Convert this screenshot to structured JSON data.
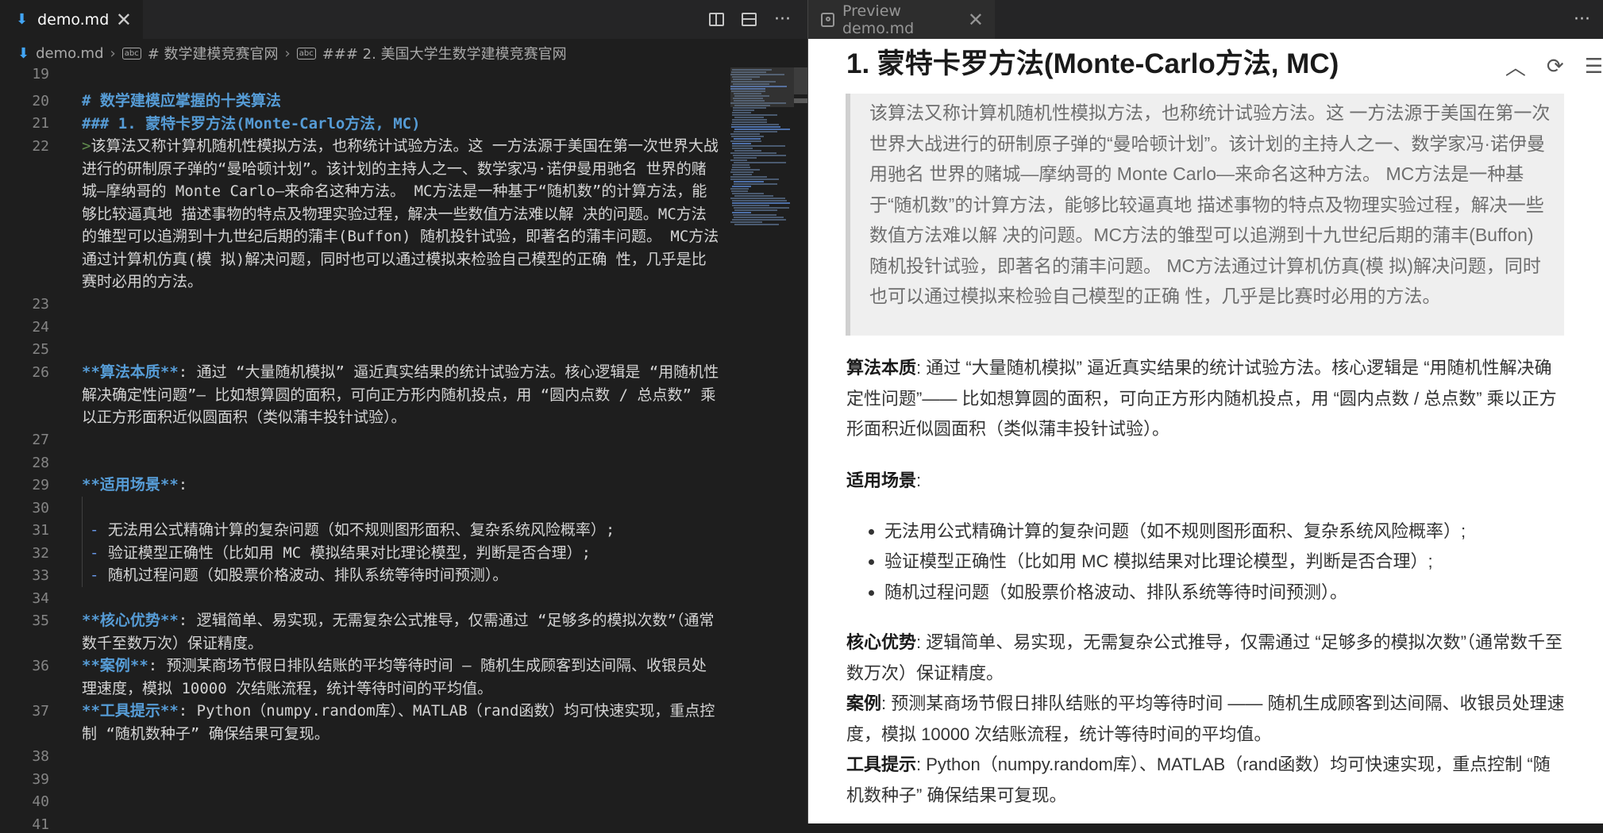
{
  "editor": {
    "tab": {
      "filename": "demo.md",
      "close": "✕"
    },
    "actions": {
      "more": "···"
    },
    "breadcrumb": {
      "file": "demo.md",
      "h1": "# 数学建模竞赛官网",
      "h2": "### 2. 美国大学生数学建模竞赛官网"
    },
    "lines": {
      "n19": "19",
      "n20": "20",
      "n21": "21",
      "n22": "22",
      "n23": "23",
      "n24": "24",
      "n25": "25",
      "n26": "26",
      "n27": "27",
      "n28": "28",
      "n29": "29",
      "n30": "30",
      "n31": "31",
      "n32": "32",
      "n33": "33",
      "n34": "34",
      "n35": "35",
      "n36": "36",
      "n37": "37",
      "n38": "38",
      "n39": "39",
      "n40": "40",
      "n41": "41"
    },
    "code": {
      "l20": "# 数学建模应掌握的十类算法",
      "l21": "### 1. 蒙特卡罗方法(Monte-Carlo方法, MC)",
      "l22_marker": ">",
      "l22": "该算法又称计算机随机性模拟方法，也称统计试验方法。这 一方法源于美国在第一次世界大战进行的研制原子弹的“曼哈顿计划”。该计划的主持人之一、数学家冯·诺伊曼用驰名 世界的赌城—摩纳哥的 Monte Carlo—来命名这种方法。 MC方法是一种基于“随机数”的计算方法，能够比较逼真地 描述事物的特点及物理实验过程，解决一些数值方法难以解 决的问题。MC方法的雏型可以追溯到十九世纪后期的蒲丰(Buffon) 随机投针试验，即著名的蒲丰问题。 MC方法通过计算机仿真(模 拟)解决问题，同时也可以通过模拟来检验自己模型的正确 性，几乎是比赛时必用的方法。",
      "l26_bold": "**算法本质**",
      "l26": ": 通过 “大量随机模拟” 逼近真实结果的统计试验方法。核心逻辑是 “用随机性解决确定性问题”— 比如想算圆的面积，可向正方形内随机投点，用 “圆内点数 / 总点数” 乘以正方形面积近似圆面积（类似蒲丰投针试验）。",
      "l29_bold": "**适用场景**",
      "l29": ":",
      "dash": "-",
      "l31": "无法用公式精确计算的复杂问题（如不规则图形面积、复杂系统风险概率）;",
      "l32": "验证模型正确性（比如用 MC 模拟结果对比理论模型，判断是否合理）;",
      "l33": "随机过程问题（如股票价格波动、排队系统等待时间预测）。",
      "l35_bold": "**核心优势**",
      "l35": ": 逻辑简单、易实现，无需复杂公式推导，仅需通过 “足够多的模拟次数”（通常数千至数万次）保证精度。",
      "l36_bold": "**案例**",
      "l36": ": 预测某商场节假日排队结账的平均等待时间 — 随机生成顾客到达间隔、收银员处理速度，模拟 10000 次结账流程，统计等待时间的平均值。",
      "l37_bold": "**工具提示**",
      "l37": ": Python（numpy.random库）、MATLAB（rand函数）均可快速实现，重点控制 “随机数种子” 确保结果可复现。"
    }
  },
  "preview": {
    "tab": {
      "title": "Preview demo.md",
      "close": "✕"
    },
    "actions": {
      "more": "···"
    },
    "heading": "1. 蒙特卡罗方法(Monte-Carlo方法, MC)",
    "tools": {
      "up": "︿",
      "refresh": "⟳",
      "toc": "☰"
    },
    "quote": "该算法又称计算机随机性模拟方法，也称统计试验方法。这 一方法源于美国在第一次世界大战进行的研制原子弹的“曼哈顿计划”。该计划的主持人之一、数学家冯·诺伊曼用驰名 世界的赌城—摩纳哥的 Monte Carlo—来命名这种方法。 MC方法是一种基于“随机数”的计算方法，能够比较逼真地 描述事物的特点及物理实验过程，解决一些数值方法难以解 决的问题。MC方法的雏型可以追溯到十九世纪后期的蒲丰(Buffon) 随机投针试验，即著名的蒲丰问题。 MC方法通过计算机仿真(模 拟)解决问题，同时也可以通过模拟来检验自己模型的正确 性，几乎是比赛时必用的方法。",
    "essence_label": "算法本质",
    "essence": ": 通过 “大量随机模拟” 逼近真实结果的统计试验方法。核心逻辑是 “用随机性解决确定性问题”—— 比如想算圆的面积，可向正方形内随机投点，用 “圆内点数 / 总点数” 乘以正方形面积近似圆面积（类似蒲丰投针试验）。",
    "scenario_label": "适用场景",
    "scenario_colon": ":",
    "scenarios": [
      "无法用公式精确计算的复杂问题（如不规则图形面积、复杂系统风险概率）;",
      "验证模型正确性（比如用 MC 模拟结果对比理论模型，判断是否合理）;",
      "随机过程问题（如股票价格波动、排队系统等待时间预测）。"
    ],
    "advantage_label": "核心优势",
    "advantage": ": 逻辑简单、易实现，无需复杂公式推导，仅需通过 “足够多的模拟次数”（通常数千至数万次）保证精度。",
    "case_label": "案例",
    "case": ": 预测某商场节假日排队结账的平均等待时间 —— 随机生成顾客到达间隔、收银员处理速度，模拟 10000 次结账流程，统计等待时间的平均值。",
    "tool_label": "工具提示",
    "tool": ": Python（numpy.random库）、MATLAB（rand函数）均可快速实现，重点控制 “随机数种子” 确保结果可复现。"
  },
  "colors": {
    "editor_bg": "#1e1e1e",
    "heading_blue": "#569cd6",
    "preview_bg": "#ffffff",
    "quote_bg": "#efefef"
  }
}
